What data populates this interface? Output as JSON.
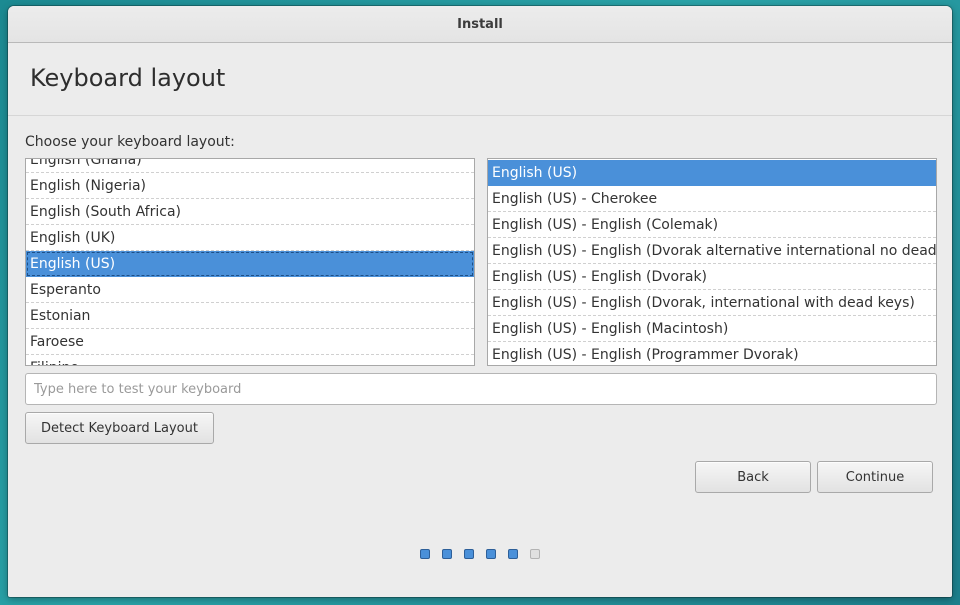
{
  "window": {
    "title": "Install"
  },
  "page": {
    "heading": "Keyboard layout",
    "prompt": "Choose your keyboard layout:"
  },
  "layouts": {
    "items": [
      {
        "label": "English (Ghana)",
        "selected": false
      },
      {
        "label": "English (Nigeria)",
        "selected": false
      },
      {
        "label": "English (South Africa)",
        "selected": false
      },
      {
        "label": "English (UK)",
        "selected": false
      },
      {
        "label": "English (US)",
        "selected": true
      },
      {
        "label": "Esperanto",
        "selected": false
      },
      {
        "label": "Estonian",
        "selected": false
      },
      {
        "label": "Faroese",
        "selected": false
      },
      {
        "label": "Filipino",
        "selected": false
      }
    ]
  },
  "variants": {
    "items": [
      {
        "label": "English (US)",
        "selected": true
      },
      {
        "label": "English (US) - Cherokee",
        "selected": false
      },
      {
        "label": "English (US) - English (Colemak)",
        "selected": false
      },
      {
        "label": "English (US) - English (Dvorak alternative international no dead keys)",
        "selected": false
      },
      {
        "label": "English (US) - English (Dvorak)",
        "selected": false
      },
      {
        "label": "English (US) - English (Dvorak, international with dead keys)",
        "selected": false
      },
      {
        "label": "English (US) - English (Macintosh)",
        "selected": false
      },
      {
        "label": "English (US) - English (Programmer Dvorak)",
        "selected": false
      }
    ]
  },
  "test_field": {
    "value": "",
    "placeholder": "Type here to test your keyboard"
  },
  "buttons": {
    "detect": "Detect Keyboard Layout",
    "back": "Back",
    "continue": "Continue"
  },
  "progress": {
    "total_steps": 6,
    "completed_steps": 5
  },
  "colors": {
    "selection": "#4a90d9",
    "window_bg": "#ececec"
  }
}
